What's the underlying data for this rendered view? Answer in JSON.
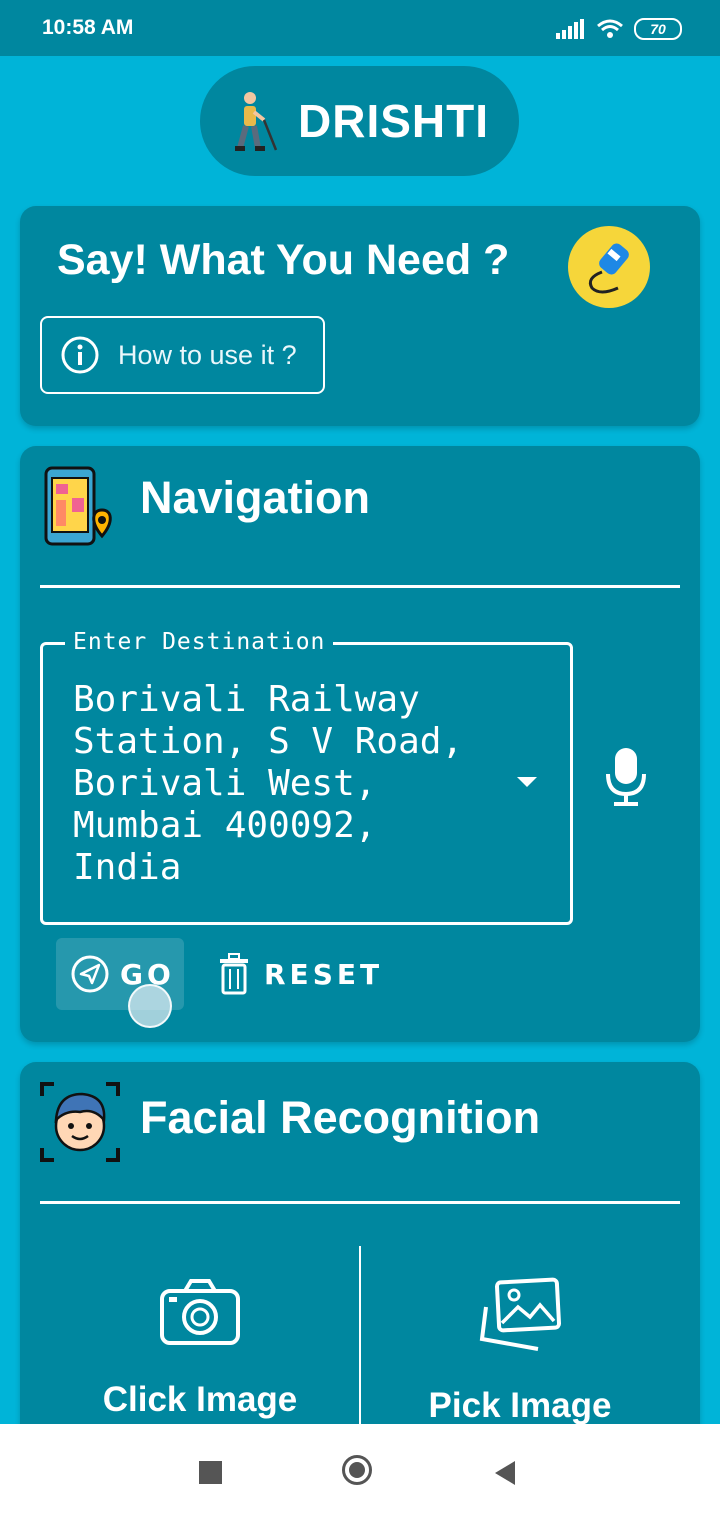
{
  "status_bar": {
    "time": "10:58 AM",
    "battery": "70"
  },
  "app": {
    "title": "DRISHTI",
    "logo_icon": "blind-person-cane-icon"
  },
  "voice_card": {
    "title": "Say! What You Need ?",
    "mic_icon": "microphone-badge-icon",
    "help_button": "How to use it ?"
  },
  "navigation": {
    "title": "Navigation",
    "field_label": "Enter Destination",
    "destination": "Borivali Railway\nStation, S V Road,\nBorivali West,\nMumbai 400092,\nIndia",
    "go_label": "GO",
    "reset_label": "RESET"
  },
  "facial": {
    "title": "Facial Recognition",
    "click_label": "Click Image",
    "pick_label": "Pick Image"
  },
  "colors": {
    "background": "#00b4d8",
    "card": "#00879f",
    "badge": "#f6d63a"
  }
}
